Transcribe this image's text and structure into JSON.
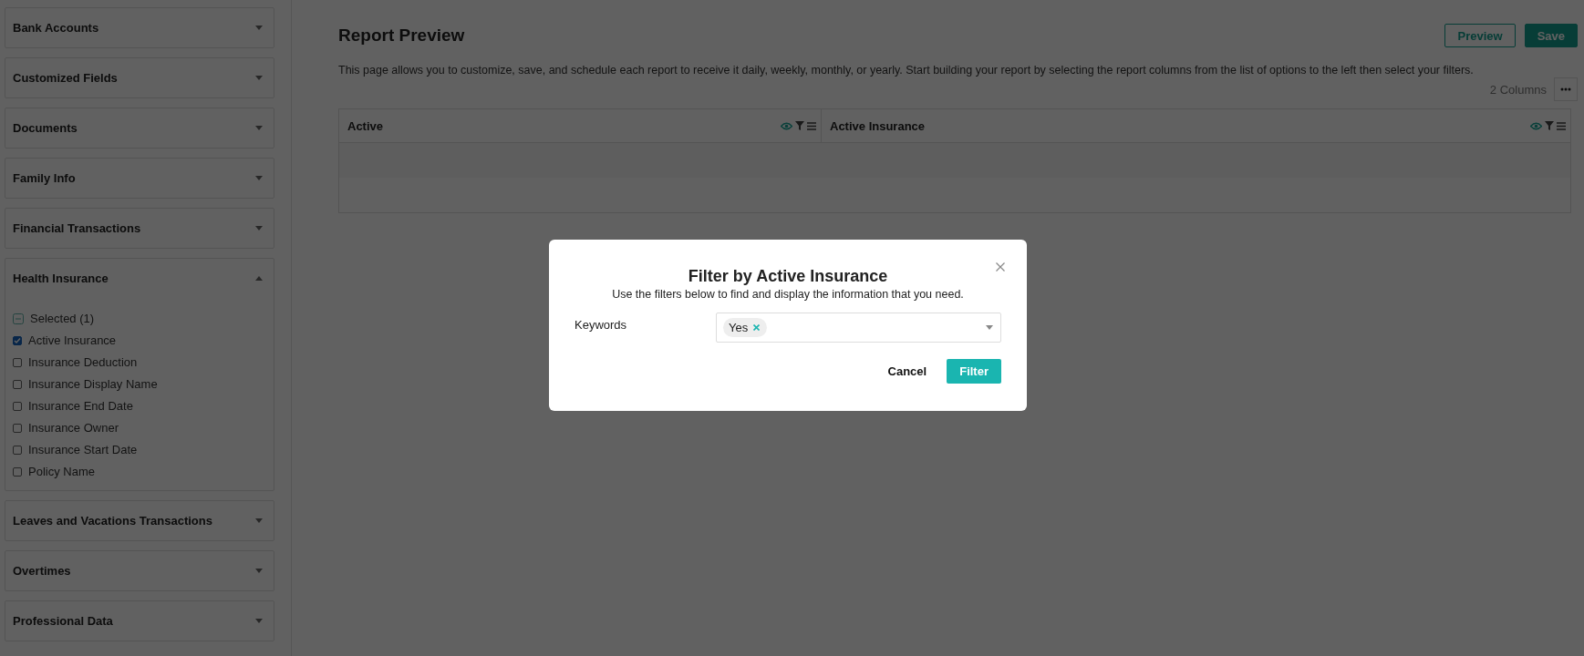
{
  "sidebar": {
    "sections": [
      {
        "title": "Bank Accounts",
        "expanded": false
      },
      {
        "title": "Customized Fields",
        "expanded": false
      },
      {
        "title": "Documents",
        "expanded": false
      },
      {
        "title": "Family Info",
        "expanded": false
      },
      {
        "title": "Financial Transactions",
        "expanded": false
      },
      {
        "title": "Health Insurance",
        "expanded": true,
        "summary": "Selected (1)",
        "items": [
          {
            "label": "Active Insurance",
            "checked": true
          },
          {
            "label": "Insurance Deduction",
            "checked": false
          },
          {
            "label": "Insurance Display Name",
            "checked": false
          },
          {
            "label": "Insurance End Date",
            "checked": false
          },
          {
            "label": "Insurance Owner",
            "checked": false
          },
          {
            "label": "Insurance Start Date",
            "checked": false
          },
          {
            "label": "Policy Name",
            "checked": false
          }
        ]
      },
      {
        "title": "Leaves and Vacations Transactions",
        "expanded": false
      },
      {
        "title": "Overtimes",
        "expanded": false
      },
      {
        "title": "Professional Data",
        "expanded": false
      }
    ]
  },
  "main": {
    "title": "Report Preview",
    "buttons": [
      {
        "label": "Preview",
        "kind": "outline"
      },
      {
        "label": "Save",
        "kind": "primary"
      }
    ],
    "description": "This page allows you to customize, save, and schedule each report to receive it daily, weekly, monthly, or yearly. Start building your report by selecting the report columns from the list of options to the left then select your filters.",
    "column_count": "2 Columns",
    "table": {
      "columns": [
        {
          "label": "Active"
        },
        {
          "label": "Active Insurance"
        }
      ]
    }
  },
  "modal": {
    "title": "Filter by Active Insurance",
    "subtitle": "Use the filters below to find and display the information that you need.",
    "field": {
      "label": "Keywords",
      "tags": [
        "Yes"
      ]
    },
    "buttons": [
      {
        "label": "Cancel",
        "kind": "text"
      },
      {
        "label": "Filter",
        "kind": "primary"
      }
    ]
  }
}
